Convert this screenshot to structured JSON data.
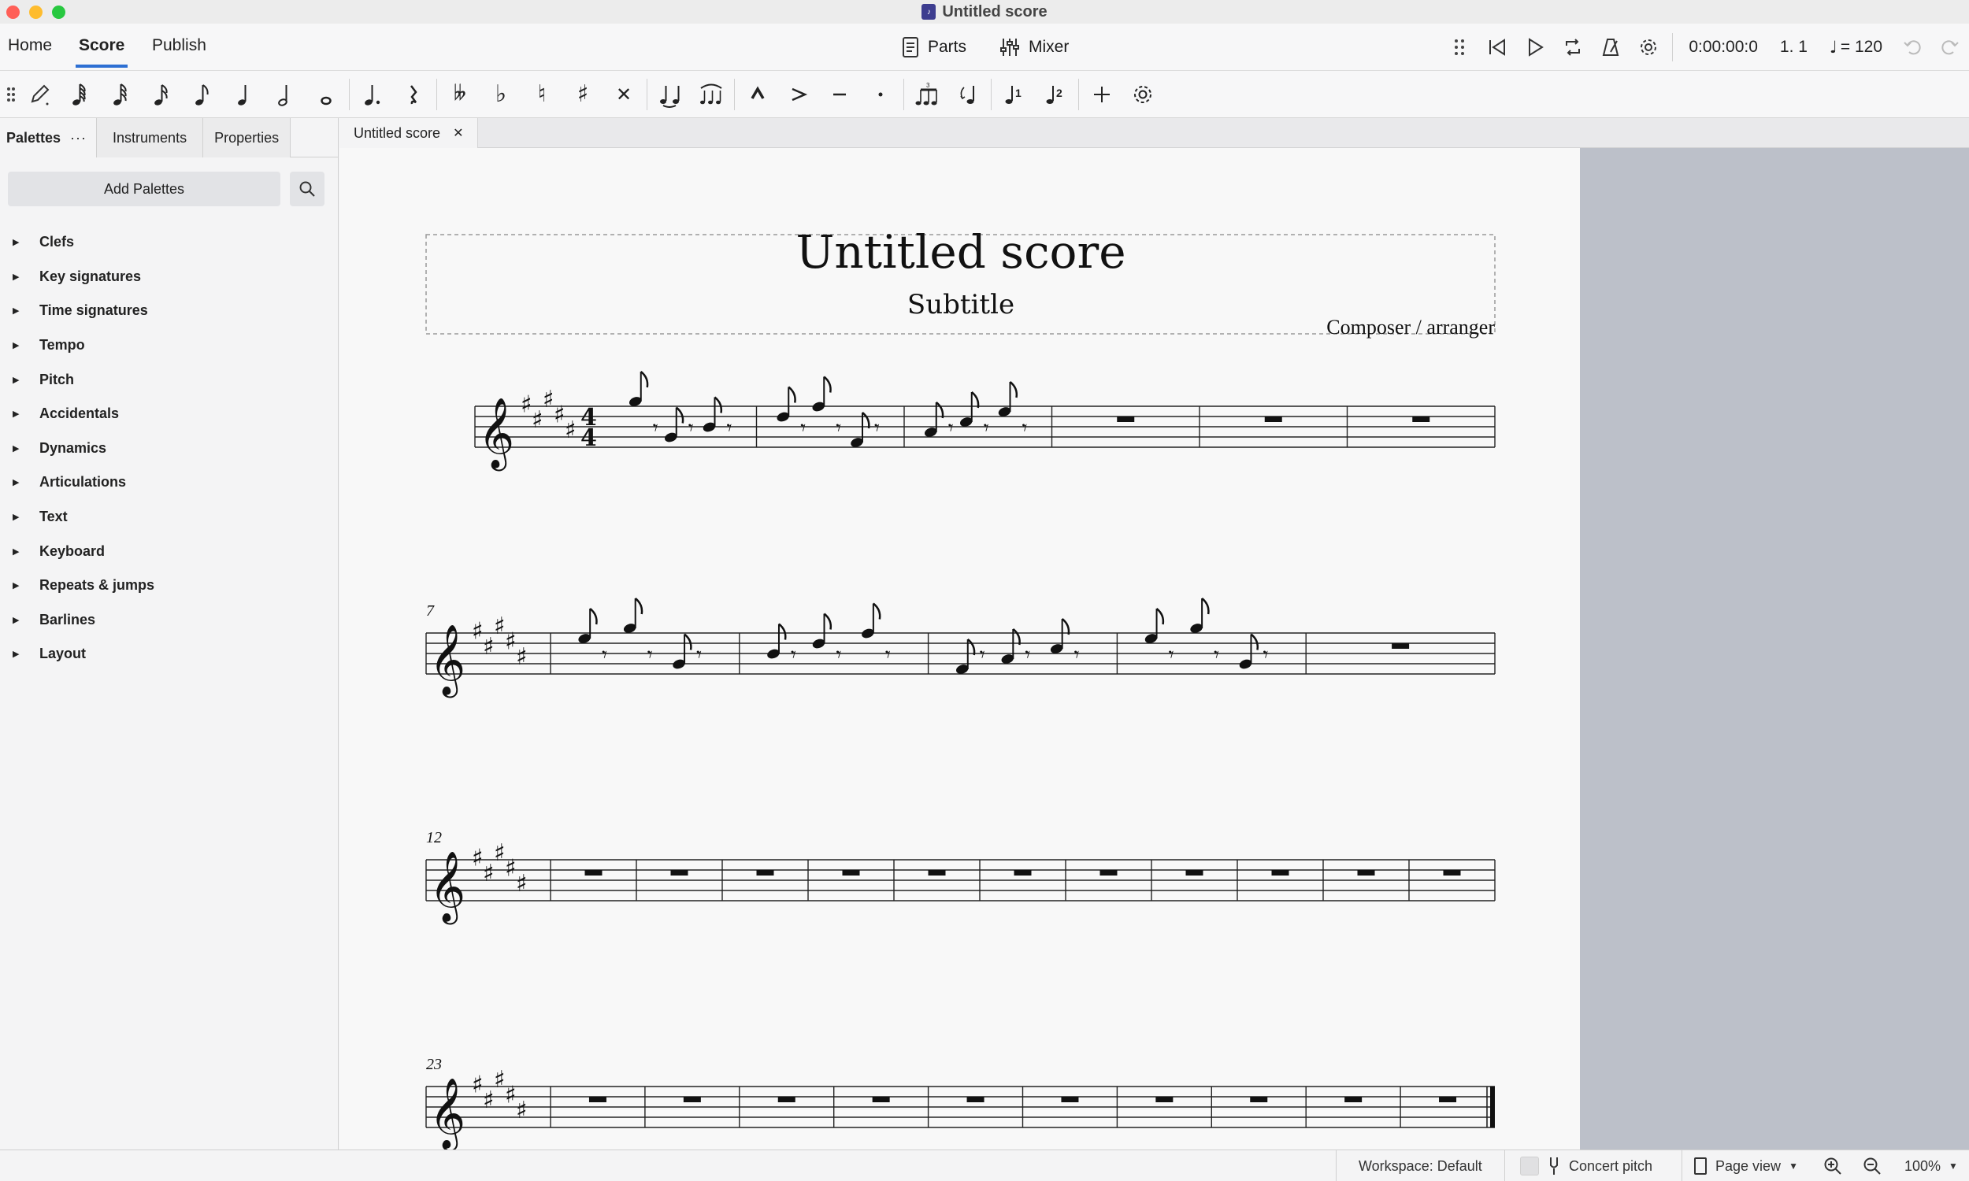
{
  "window": {
    "title": "Untitled score",
    "app_icon": "musescore-icon"
  },
  "menu": {
    "tabs": [
      "Home",
      "Score",
      "Publish"
    ],
    "active_tab": "Score",
    "parts_label": "Parts",
    "mixer_label": "Mixer"
  },
  "playback": {
    "time": "0:00:00:0",
    "position": "1. 1",
    "tempo": "= 120"
  },
  "left_panel": {
    "tabs": [
      "Palettes",
      "Instruments",
      "Properties"
    ],
    "more": "···",
    "add_palettes": "Add Palettes",
    "palettes": [
      "Clefs",
      "Key signatures",
      "Time signatures",
      "Tempo",
      "Pitch",
      "Accidentals",
      "Dynamics",
      "Articulations",
      "Text",
      "Keyboard",
      "Repeats & jumps",
      "Barlines",
      "Layout"
    ]
  },
  "document_tab": {
    "label": "Untitled score",
    "close": "✕"
  },
  "score": {
    "title": "Untitled score",
    "subtitle": "Subtitle",
    "composer": "Composer / arranger",
    "key_signature": "B major (5 sharps)",
    "time_signature": {
      "top": "4",
      "bottom": "4"
    },
    "systems": [
      {
        "start_measure": "",
        "measures": 6
      },
      {
        "start_measure": "7",
        "measures": 5
      },
      {
        "start_measure": "12",
        "measures": 11
      },
      {
        "start_measure": "23",
        "measures": 10
      }
    ]
  },
  "status": {
    "workspace": "Workspace: Default",
    "concert_pitch": "Concert pitch",
    "view_mode": "Page view",
    "zoom": "100%"
  },
  "colors": {
    "accent": "#2d6fd3",
    "page": "#f8f8f8",
    "canvas": "#bcc0c9",
    "panel": "#f4f4f5"
  }
}
